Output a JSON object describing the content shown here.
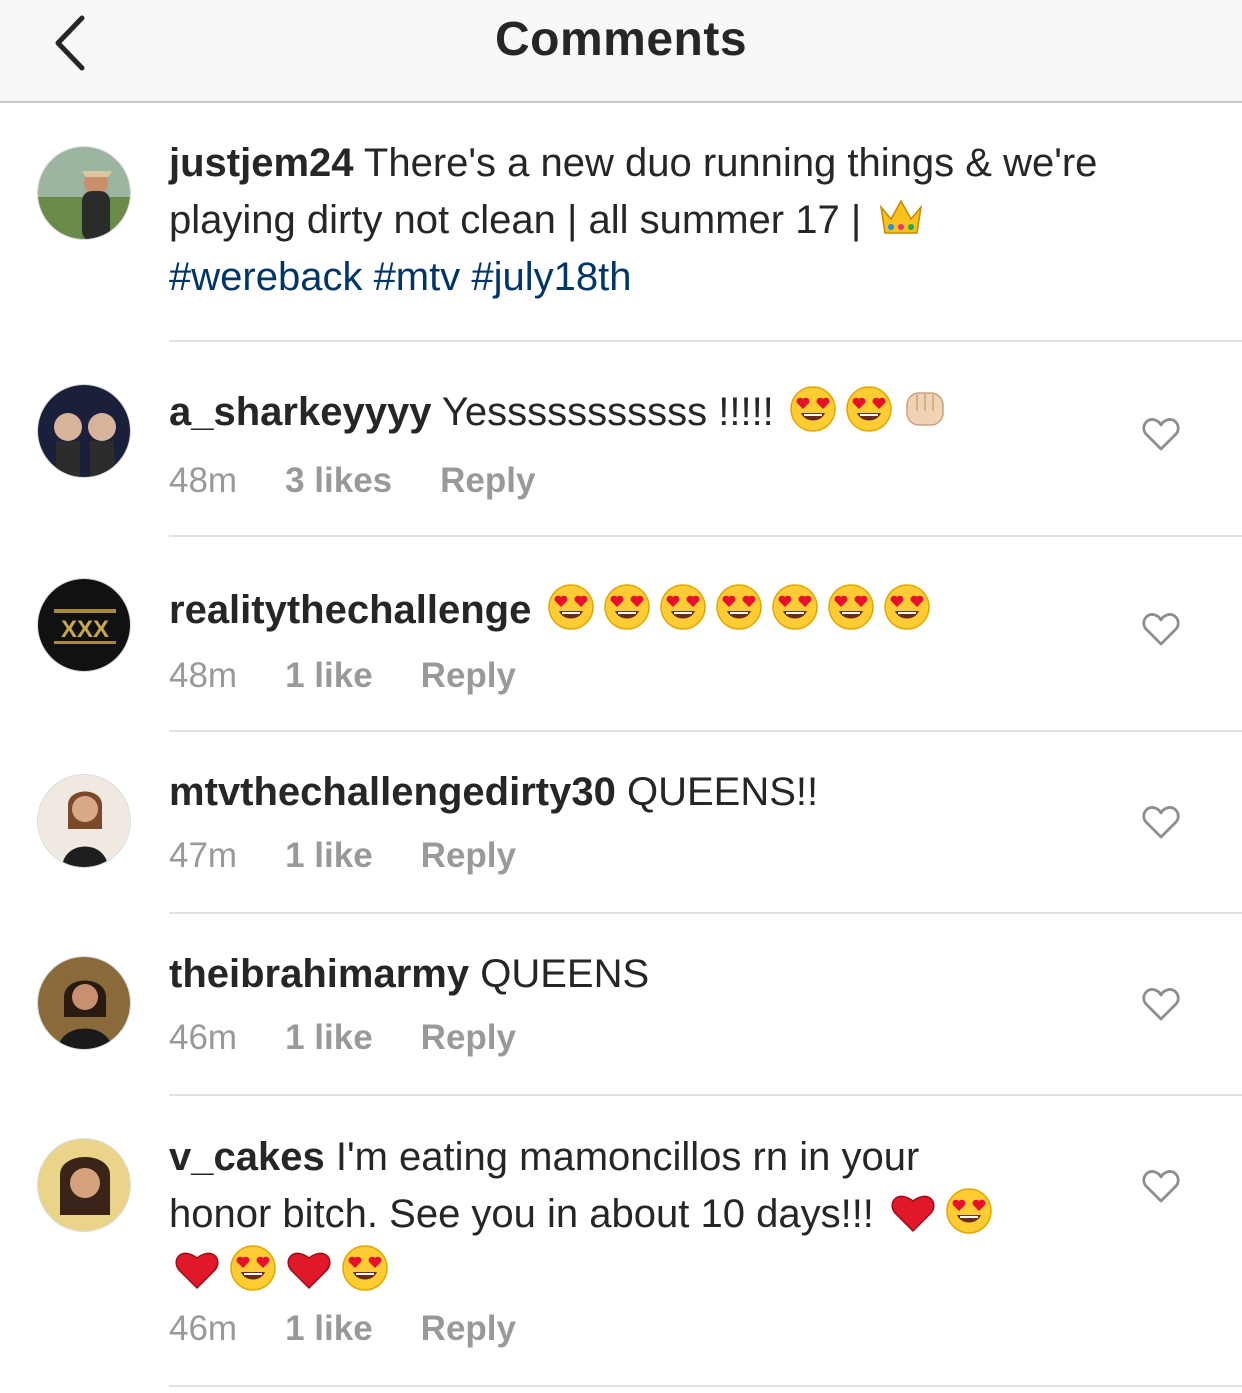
{
  "nav": {
    "title": "Comments"
  },
  "caption": {
    "username": "justjem24",
    "text": "There's a new duo running things & we're playing dirty not clean | all summer 17 |",
    "emoji": [
      "crown"
    ],
    "hashtags": [
      "#wereback",
      "#mtv",
      "#july18th"
    ]
  },
  "comments": [
    {
      "username": "a_sharkeyyyy",
      "text": "Yesssssssssss !!!!!",
      "emoji": [
        "heart-eyes",
        "heart-eyes",
        "fist"
      ],
      "time": "48m",
      "likes": "3 likes",
      "reply": "Reply"
    },
    {
      "username": "realitythechallenge",
      "text": "",
      "emoji": [
        "heart-eyes",
        "heart-eyes",
        "heart-eyes",
        "heart-eyes",
        "heart-eyes",
        "heart-eyes",
        "heart-eyes"
      ],
      "time": "48m",
      "likes": "1 like",
      "reply": "Reply",
      "avatar_text": "XXX"
    },
    {
      "username": "mtvthechallengedirty30",
      "text": "QUEENS!!",
      "emoji": [],
      "time": "47m",
      "likes": "1 like",
      "reply": "Reply"
    },
    {
      "username": "theibrahimarmy",
      "text": "QUEENS",
      "emoji": [],
      "time": "46m",
      "likes": "1 like",
      "reply": "Reply"
    },
    {
      "username": "v_cakes",
      "text_line1": "I'm eating mamoncillos rn in your",
      "text_line2": "honor bitch.  See you in about 10 days!!!",
      "emoji_line2": [
        "red-heart",
        "heart-eyes"
      ],
      "emoji_line3": [
        "red-heart",
        "heart-eyes",
        "red-heart",
        "heart-eyes"
      ],
      "time": "46m",
      "likes": "1 like",
      "reply": "Reply"
    }
  ],
  "colors": {
    "text": "#262626",
    "meta": "#999999",
    "hashtag": "#003569",
    "divider": "#e2e2e2",
    "navbar": "#f8f8f8"
  }
}
